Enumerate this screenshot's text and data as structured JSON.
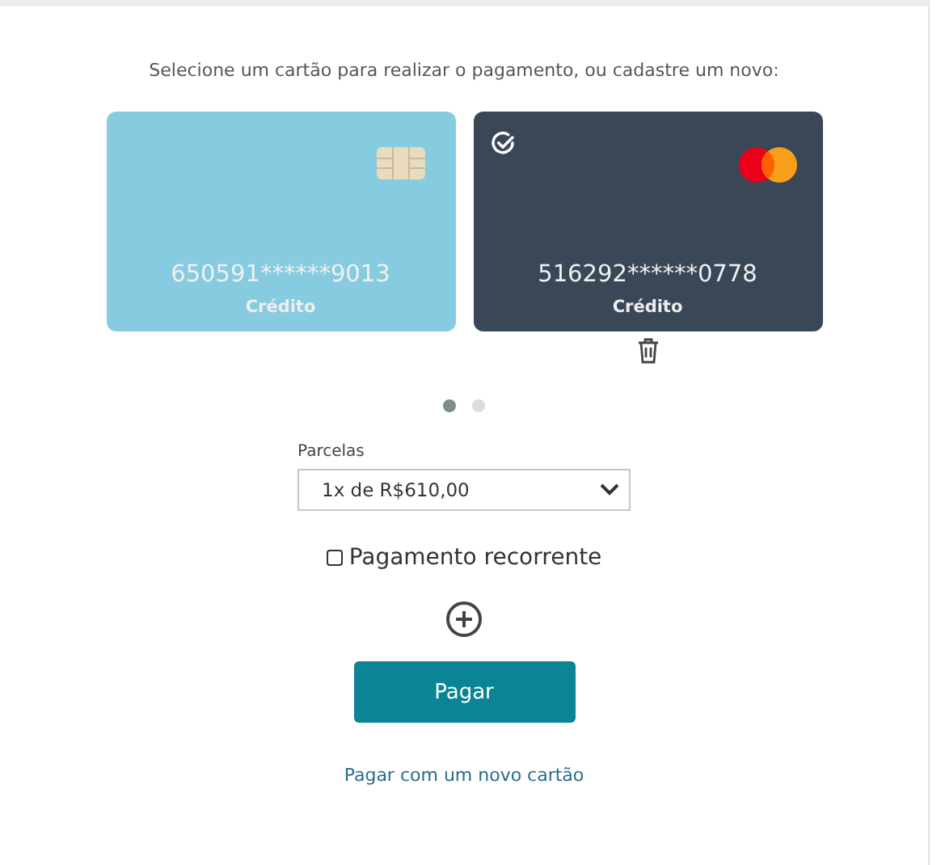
{
  "prompt": "Selecione um cartão para realizar o pagamento, ou cadastre um novo:",
  "cards": [
    {
      "number": "650591******9013",
      "type": "Crédito",
      "kind": "chip",
      "color": "#86cbdf",
      "selected": false
    },
    {
      "number": "516292******0778",
      "type": "Crédito",
      "kind": "mastercard",
      "color": "#3a4756",
      "selected": true
    }
  ],
  "pager": [
    {
      "selected": true
    },
    {
      "selected": false
    }
  ],
  "installments": {
    "label": "Parcelas",
    "value": "1x de R$610,00"
  },
  "recurring": {
    "label": "Pagamento recorrente",
    "checked": false
  },
  "pay_button": "Pagar",
  "new_card_link": "Pagar com um novo cartão"
}
